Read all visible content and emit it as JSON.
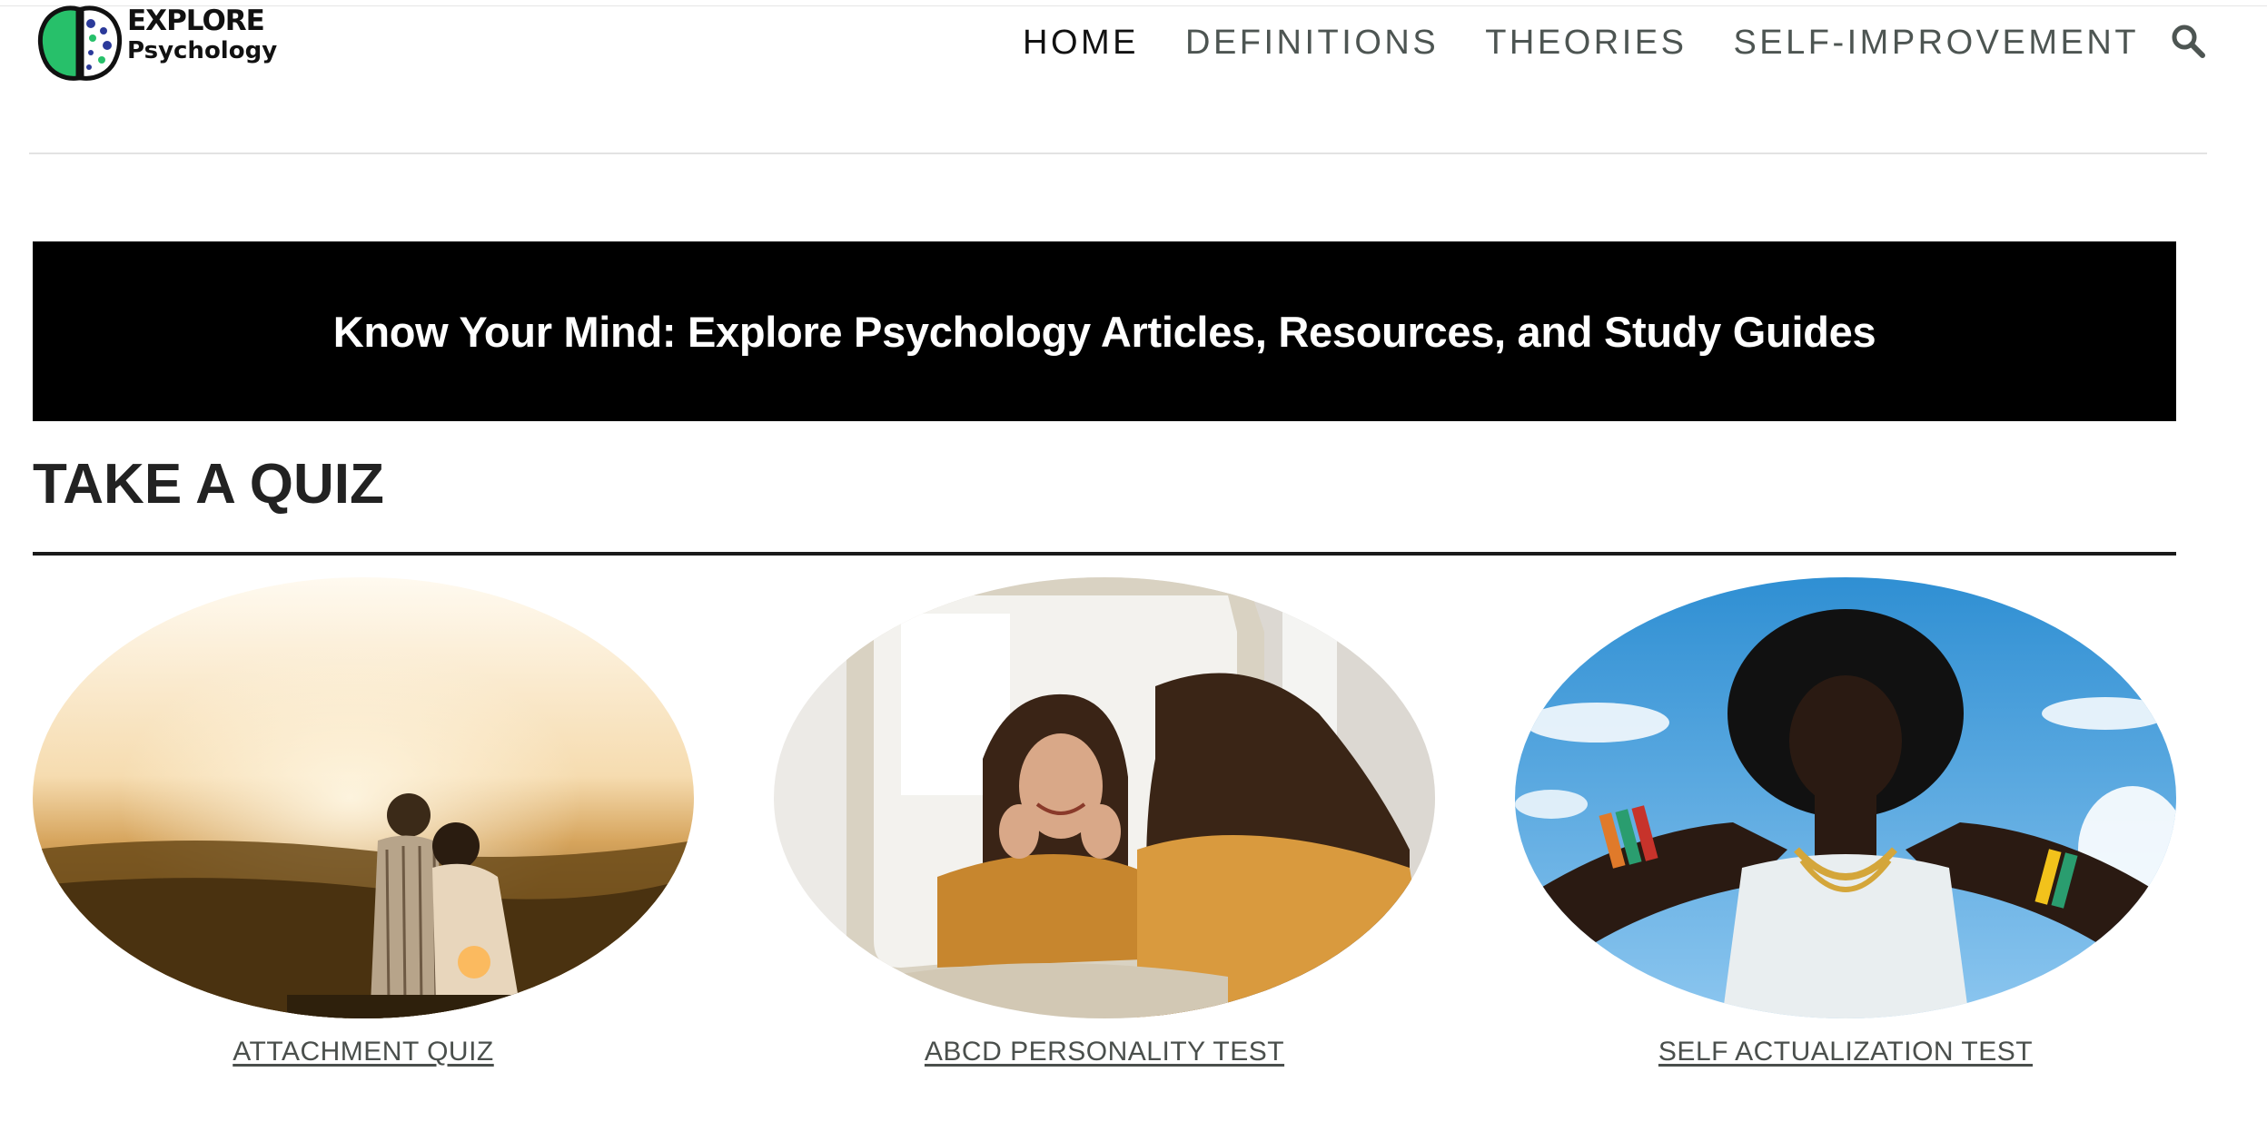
{
  "logo": {
    "line1": "EXPLORE",
    "line2": "Psychology",
    "icon": "brain-icon",
    "brand_color": "#2ecc71"
  },
  "nav": {
    "items": [
      {
        "label": "HOME",
        "active": true
      },
      {
        "label": "DEFINITIONS",
        "active": false
      },
      {
        "label": "THEORIES",
        "active": false
      },
      {
        "label": "SELF-IMPROVEMENT",
        "active": false
      }
    ],
    "search_icon": "search-icon"
  },
  "hero": {
    "title": "Know Your Mind: Explore Psychology Articles, Resources, and Study Guides"
  },
  "section": {
    "title": "TAKE A QUIZ"
  },
  "quizzes": [
    {
      "label": "ATTACHMENT QUIZ",
      "image": "couple-sunset-photo"
    },
    {
      "label": "ABCD PERSONALITY TEST",
      "image": "woman-mirror-photo"
    },
    {
      "label": "SELF ACTUALIZATION TEST",
      "image": "woman-sky-photo"
    }
  ],
  "colors": {
    "nav_text": "#4d5552",
    "nav_active": "#111111",
    "banner_bg": "#000000",
    "banner_text": "#ffffff"
  }
}
